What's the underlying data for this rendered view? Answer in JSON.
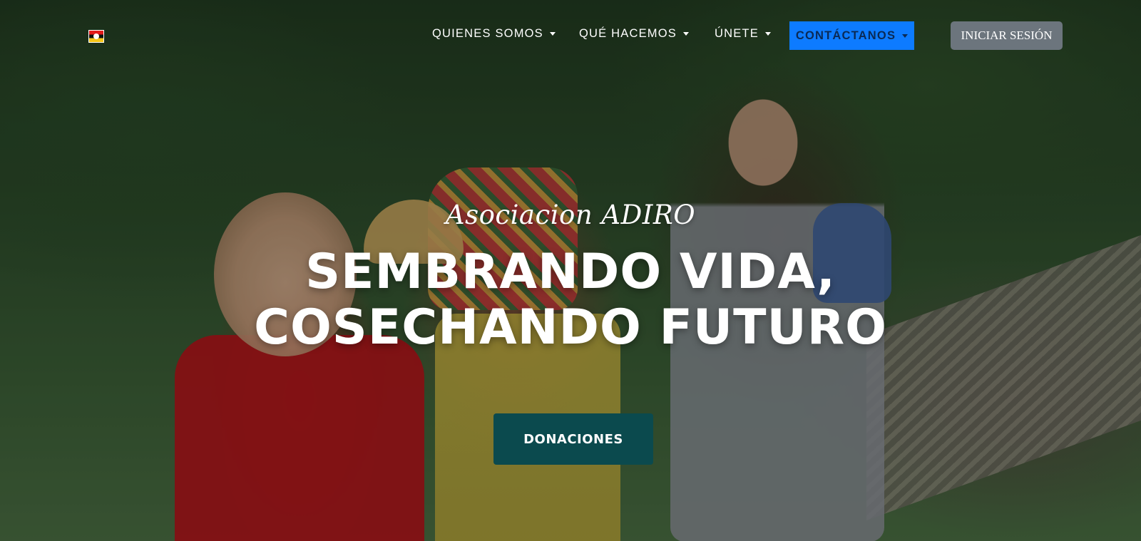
{
  "nav": {
    "items": [
      {
        "label": "QUIENES SOMOS"
      },
      {
        "label": "QUÉ HACEMOS"
      },
      {
        "label": "ÚNETE"
      }
    ],
    "contact_label": "CONTÁCTANOS",
    "login_label": "INICIAR SESIÓN"
  },
  "hero": {
    "subtitle": "Asociacion ADIRO",
    "headline_line1": "SEMBRANDO VIDA,",
    "headline_line2": "COSECHANDO FUTURO",
    "donate_label": "DONACIONES"
  },
  "colors": {
    "contact_bg": "#0d7bff",
    "login_bg": "#6c757d",
    "donate_bg": "#0b4a4e"
  }
}
